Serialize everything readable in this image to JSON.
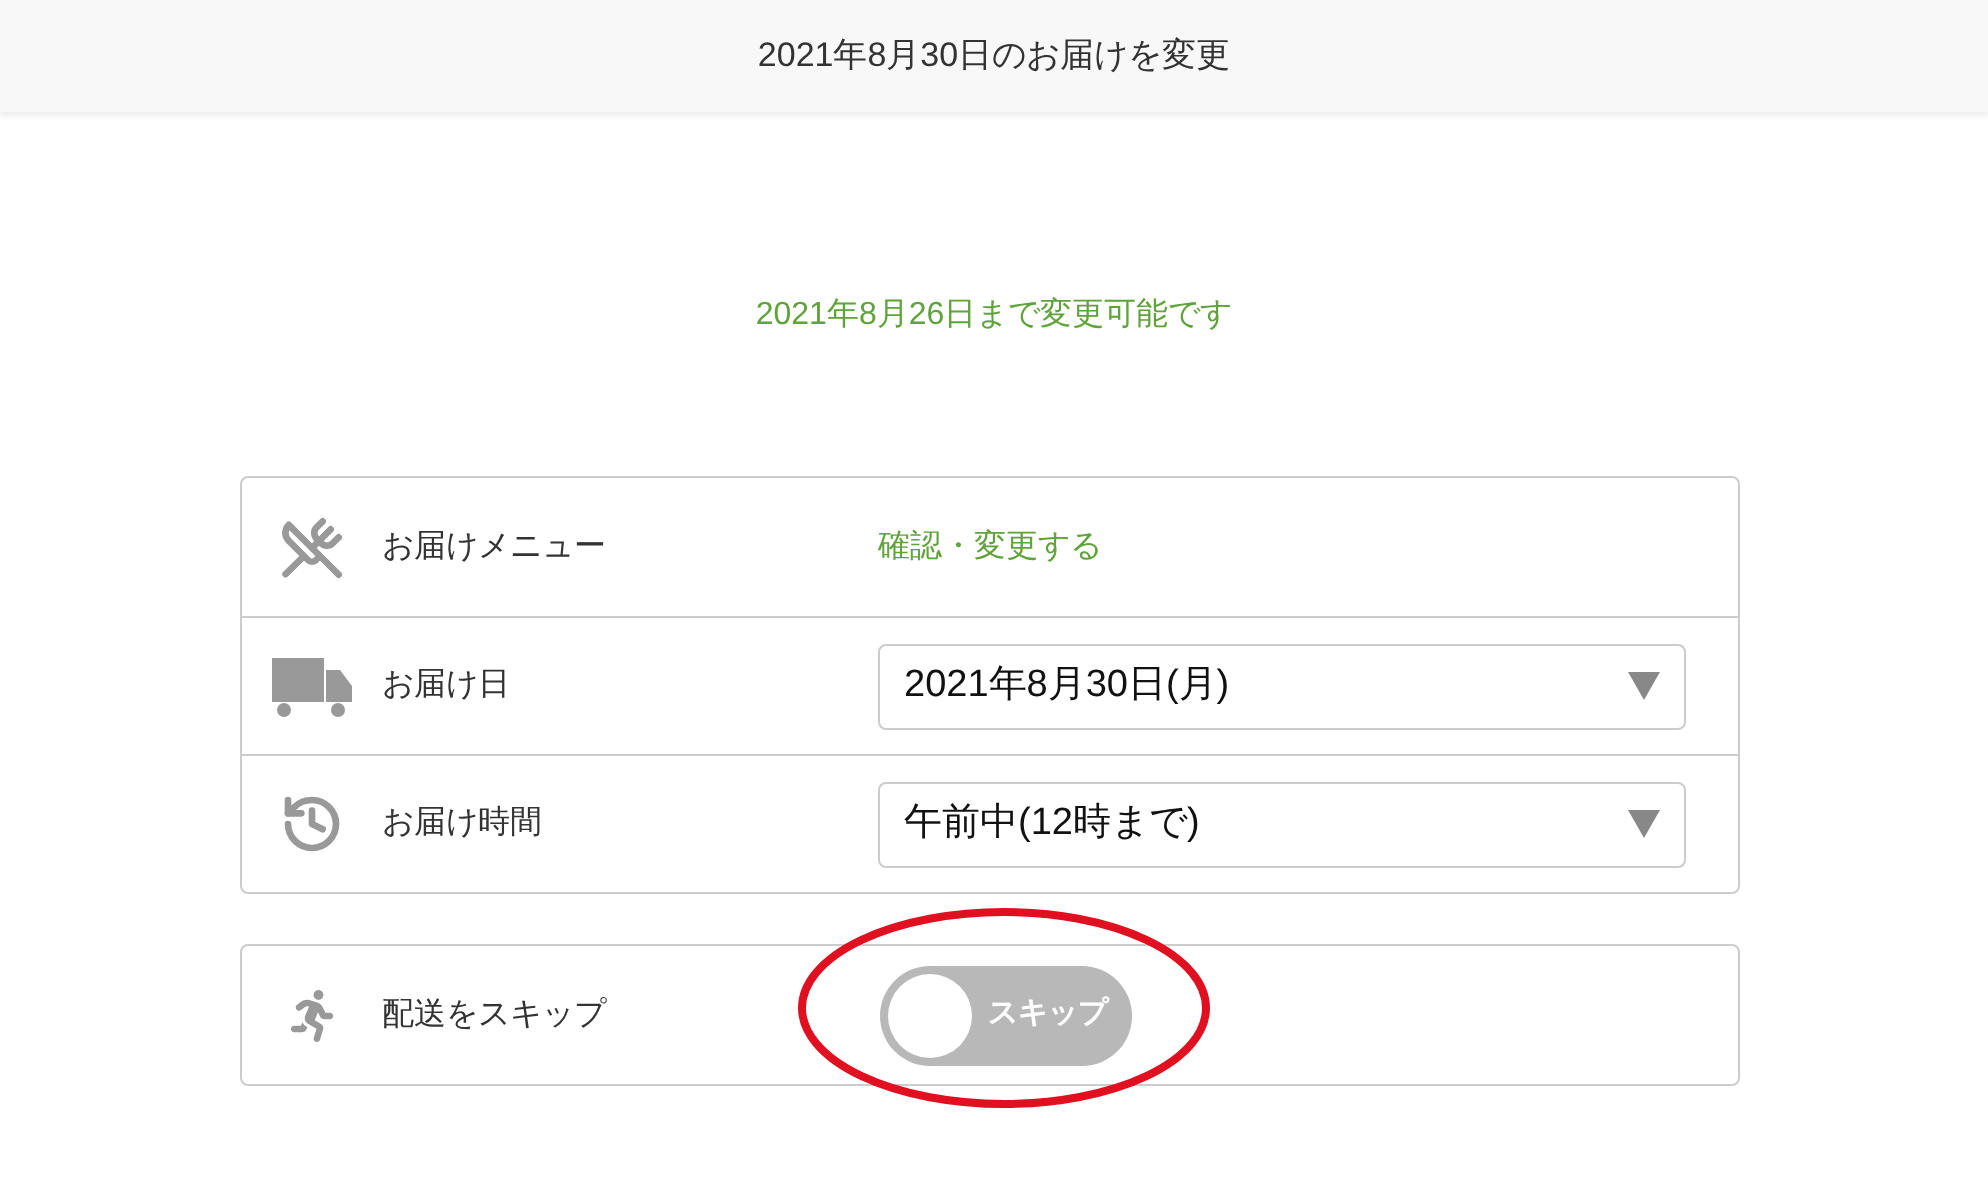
{
  "header": {
    "title": "2021年8月30日のお届けを変更"
  },
  "deadline": "2021年8月26日まで変更可能です",
  "delivery_settings": [
    {
      "kind": "link",
      "label": "お届けメニュー",
      "value": "確認・変更する"
    },
    {
      "kind": "select",
      "label": "お届け日",
      "value": "2021年8月30日(月)"
    },
    {
      "kind": "select",
      "label": "お届け時間",
      "value": "午前中(12時まで)"
    }
  ],
  "skip": {
    "label": "配送をスキップ",
    "toggle_text": "スキップ",
    "on": false
  }
}
